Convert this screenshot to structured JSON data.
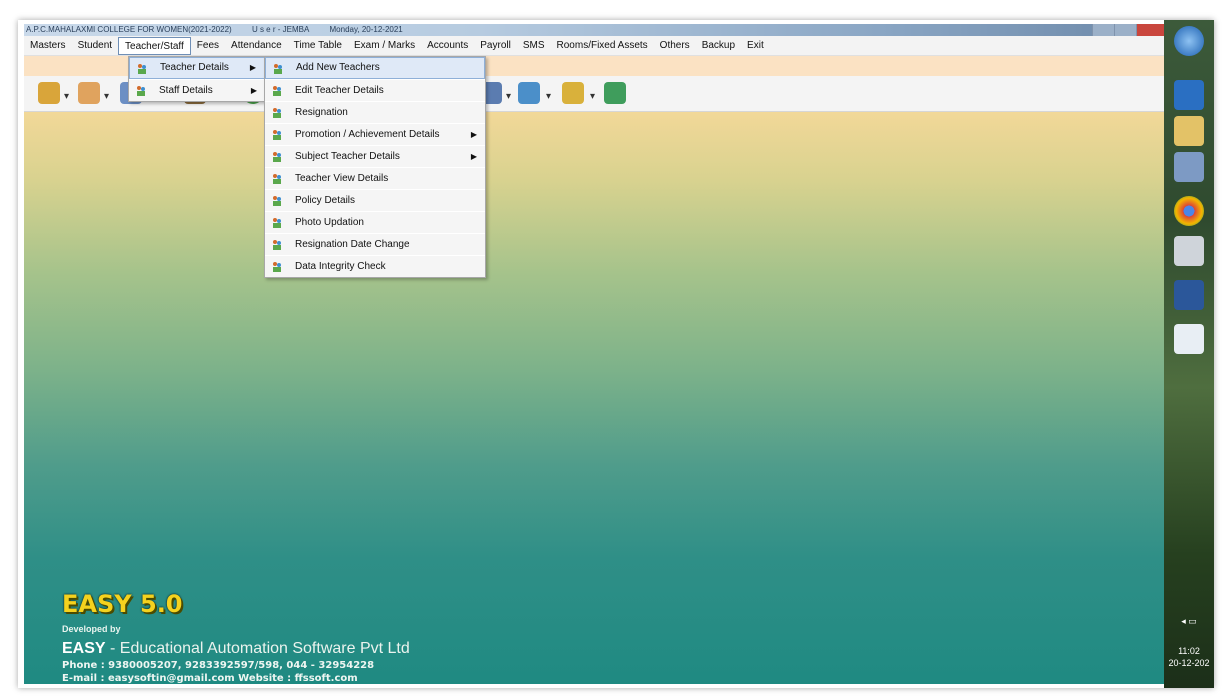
{
  "window": {
    "title_college": "A.P.C.MAHALAXMI COLLEGE FOR WOMEN(2021-2022)",
    "title_user": "U s e r - JEMBA",
    "title_date": "Monday, 20-12-2021"
  },
  "menubar": [
    "Masters",
    "Student",
    "Teacher/Staff",
    "Fees",
    "Attendance",
    "Time Table",
    "Exam / Marks",
    "Accounts",
    "Payroll",
    "SMS",
    "Rooms/Fixed Assets",
    "Others",
    "Backup",
    "Exit"
  ],
  "submenu": {
    "items": [
      {
        "label": "Teacher Details",
        "has_arrow": true
      },
      {
        "label": "Staff Details",
        "has_arrow": true
      }
    ]
  },
  "teacher_menu": {
    "items": [
      {
        "label": "Add New Teachers"
      },
      {
        "label": "Edit Teacher Details"
      },
      {
        "label": "Resignation"
      },
      {
        "label": "Promotion / Achievement Details",
        "has_arrow": true
      },
      {
        "label": "Subject Teacher Details",
        "has_arrow": true
      },
      {
        "label": "Teacher View Details"
      },
      {
        "label": "Policy Details"
      },
      {
        "label": "Photo Updation"
      },
      {
        "label": "Resignation Date Change"
      },
      {
        "label": "Data Integrity Check"
      }
    ]
  },
  "brand": {
    "product": "EASY 5.0",
    "developed_by": "Developed by",
    "company_bold": "EASY",
    "company_rest": " - Educational Automation Software Pvt Ltd",
    "phone": "Phone : 9380005207, 9283392597/598,  044 - 32954228",
    "email_line": "E-mail : easysoftin@gmail.com     Website : ffssoft.com"
  },
  "taskbar": {
    "time": "11:02",
    "date": "20-12-202"
  },
  "colors": {
    "desktop_top": "#f2d898",
    "desktop_bottom": "#1f8a82",
    "brand_yellow": "#f5d21e",
    "menu_selected": "#dfe9f7"
  }
}
